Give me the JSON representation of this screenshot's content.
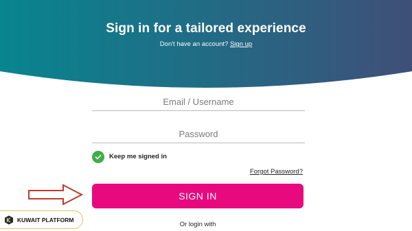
{
  "header": {
    "title": "Sign in for a tailored experience",
    "no_account_text": "Don't have an account?",
    "signup_link": "Sign up"
  },
  "form": {
    "email_placeholder": "Email / Username",
    "password_placeholder": "Password",
    "remember_label": "Keep me signed in",
    "remember_checked": true,
    "forgot_password_link": "Forgot Password?",
    "signin_button": "SIGN IN",
    "or_login_with": "Or login with"
  },
  "watermark": {
    "label": "KUWAIT PLATFORM"
  },
  "colors": {
    "hero_gradient_start": "#08858e",
    "hero_gradient_end": "#3f4f78",
    "signin_button": "#e8097f",
    "checkbox": "#3fae49",
    "arrow": "#c0392b"
  },
  "icons": {
    "checkbox": "checkmark-icon",
    "annotation": "arrow-right-icon",
    "watermark": "kuwait-platform-logo-icon"
  }
}
